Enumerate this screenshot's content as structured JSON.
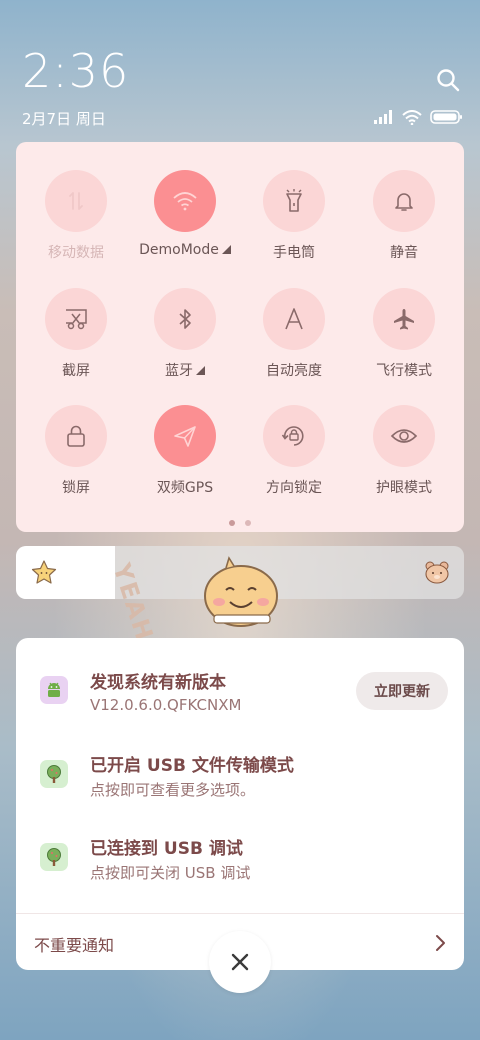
{
  "status": {
    "time": "2:36",
    "date": "2月7日 周日"
  },
  "tiles": [
    {
      "label": "移动数据",
      "icon": "mobile-data-icon",
      "state": "disabled"
    },
    {
      "label": "DemoMode",
      "icon": "wifi-icon",
      "state": "on"
    },
    {
      "label": "手电筒",
      "icon": "flashlight-icon",
      "state": "off"
    },
    {
      "label": "静音",
      "icon": "bell-icon",
      "state": "off"
    },
    {
      "label": "截屏",
      "icon": "screenshot-icon",
      "state": "off"
    },
    {
      "label": "蓝牙",
      "icon": "bluetooth-icon",
      "state": "off"
    },
    {
      "label": "自动亮度",
      "icon": "auto-brightness-icon",
      "state": "off"
    },
    {
      "label": "飞行模式",
      "icon": "airplane-icon",
      "state": "off"
    },
    {
      "label": "锁屏",
      "icon": "lock-icon",
      "state": "off"
    },
    {
      "label": "双频GPS",
      "icon": "location-arrow-icon",
      "state": "on"
    },
    {
      "label": "方向锁定",
      "icon": "rotation-lock-icon",
      "state": "off"
    },
    {
      "label": "护眼模式",
      "icon": "eye-icon",
      "state": "off"
    }
  ],
  "pager": {
    "pages": 2,
    "current": 1
  },
  "brightness": {
    "level": 0.22
  },
  "notifications": [
    {
      "title": "发现系统有新版本",
      "subtitle": "V12.0.6.0.QFKCNXM",
      "action": "立即更新",
      "icon": "android-updater-icon"
    },
    {
      "title": "已开启 USB 文件传输模式",
      "subtitle": "点按即可查看更多选项。",
      "icon": "tree-icon"
    },
    {
      "title": "已连接到 USB 调试",
      "subtitle": "点按即可关闭 USB 调试",
      "icon": "tree-icon"
    }
  ],
  "footer": {
    "unimportant_label": "不重要通知"
  },
  "sticker": {
    "text": "YEAH"
  },
  "colors": {
    "tile_on": "#fb8f92",
    "tile_off": "#fbd6d6",
    "panel_bg": "#fdeaea",
    "text_brown": "#7c4a4a"
  }
}
